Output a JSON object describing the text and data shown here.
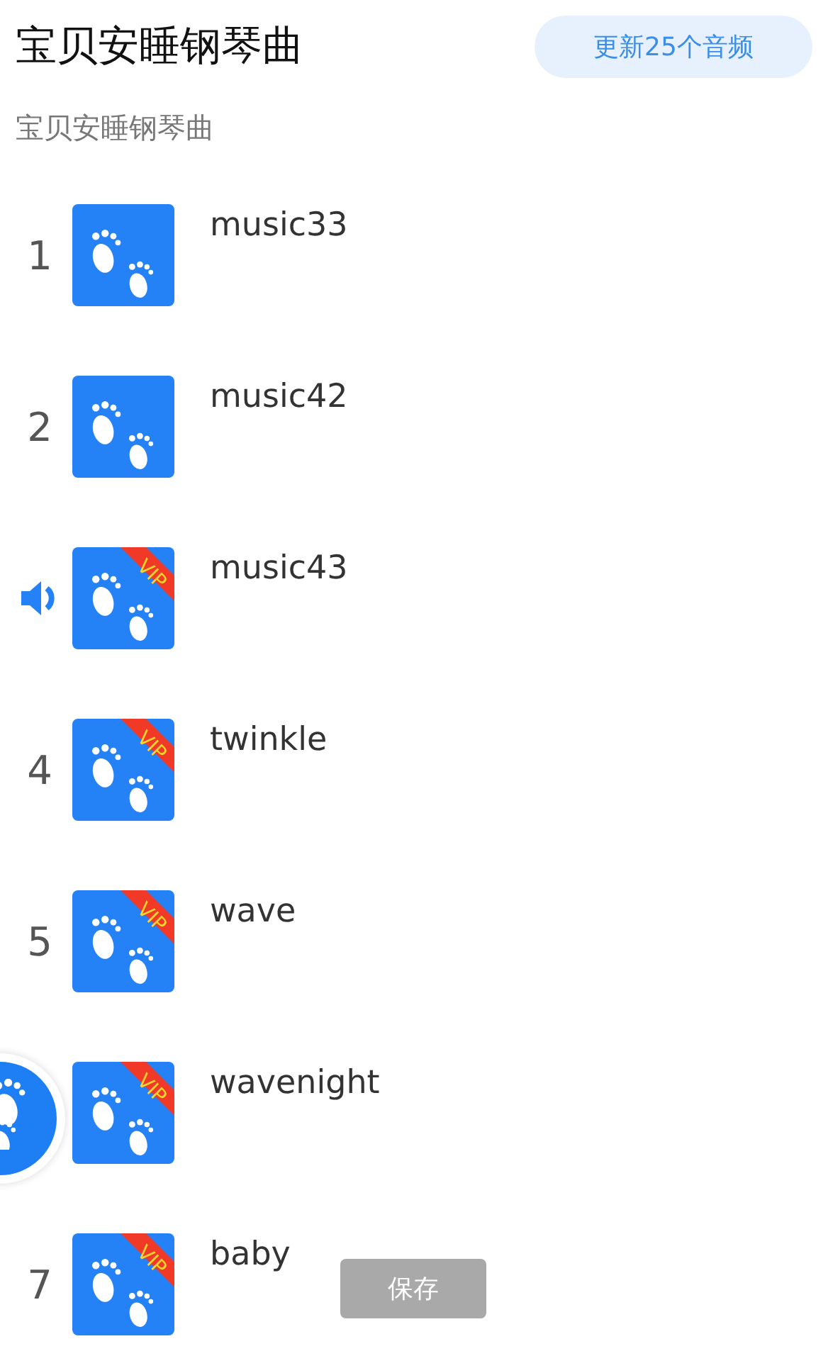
{
  "header": {
    "title": "宝贝安睡钢琴曲",
    "update_button": "更新25个音频",
    "subtitle": "宝贝安睡钢琴曲"
  },
  "tracks": [
    {
      "number": "1",
      "title": "music33",
      "vip": false,
      "playing": false
    },
    {
      "number": "2",
      "title": "music42",
      "vip": false,
      "playing": false
    },
    {
      "title": "music43",
      "vip": true,
      "badge": "VIP",
      "playing": true
    },
    {
      "number": "4",
      "title": "twinkle",
      "vip": true,
      "badge": "VIP",
      "playing": false
    },
    {
      "number": "5",
      "title": "wave",
      "vip": true,
      "badge": "VIP",
      "playing": false
    },
    {
      "title": "wavenight",
      "vip": true,
      "badge": "VIP",
      "playing": false
    },
    {
      "number": "7",
      "title": "baby",
      "vip": true,
      "badge": "VIP",
      "playing": false
    }
  ],
  "save_button": {
    "label": "保存",
    "disabled": true
  }
}
